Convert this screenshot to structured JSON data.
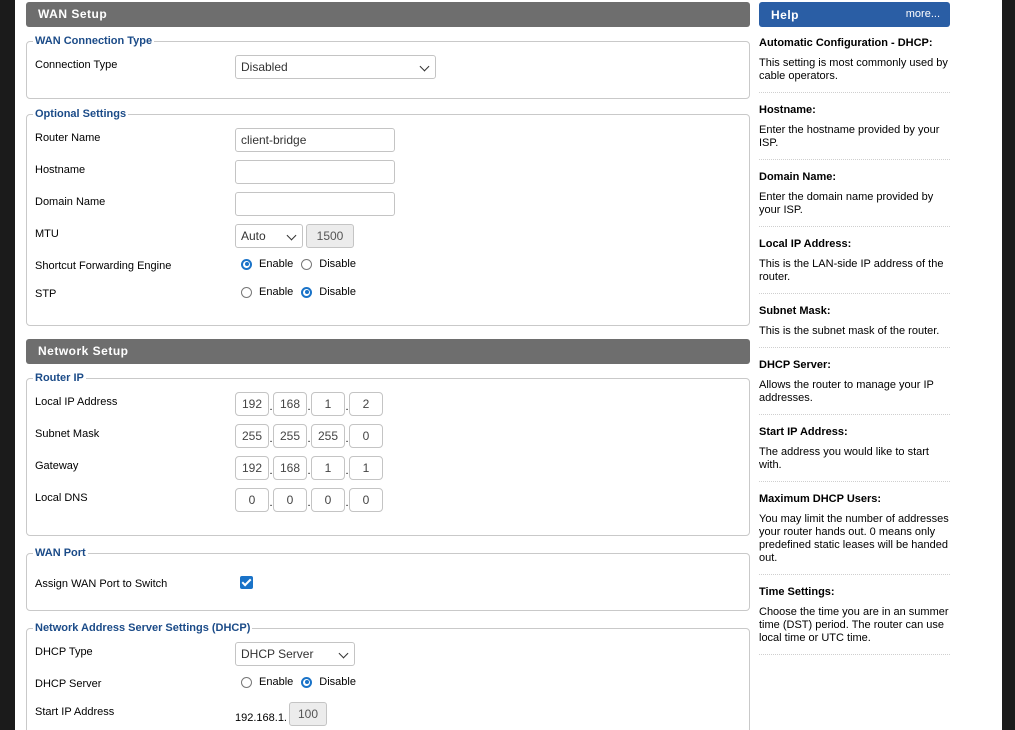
{
  "wan": {
    "header": "WAN Setup",
    "conn_legend": "WAN Connection Type",
    "conn_type_label": "Connection Type",
    "conn_type_value": "Disabled",
    "opt_legend": "Optional Settings",
    "router_name_label": "Router Name",
    "router_name_value": "client-bridge",
    "hostname_label": "Hostname",
    "hostname_value": "",
    "domain_label": "Domain Name",
    "domain_value": "",
    "mtu_label": "MTU",
    "mtu_mode": "Auto",
    "mtu_value": "1500",
    "sfe_label": "Shortcut Forwarding Engine",
    "sfe_enable": "Enable",
    "sfe_disable": "Disable",
    "stp_label": "STP",
    "stp_enable": "Enable",
    "stp_disable": "Disable"
  },
  "network": {
    "header": "Network Setup",
    "router_ip_legend": "Router IP",
    "local_ip_label": "Local IP Address",
    "local_ip": [
      "192",
      "168",
      "1",
      "2"
    ],
    "subnet_label": "Subnet Mask",
    "subnet": [
      "255",
      "255",
      "255",
      "0"
    ],
    "gateway_label": "Gateway",
    "gateway": [
      "192",
      "168",
      "1",
      "1"
    ],
    "dns_label": "Local DNS",
    "dns": [
      "0",
      "0",
      "0",
      "0"
    ],
    "wan_port_legend": "WAN Port",
    "assign_wan_label": "Assign WAN Port to Switch",
    "dhcp_legend": "Network Address Server Settings (DHCP)",
    "dhcp_type_label": "DHCP Type",
    "dhcp_type_value": "DHCP Server",
    "dhcp_server_label": "DHCP Server",
    "dhcp_enable": "Enable",
    "dhcp_disable": "Disable",
    "start_ip_label": "Start IP Address",
    "start_ip_prefix": "192.168.1.",
    "start_ip_value": "100"
  },
  "help": {
    "title": "Help",
    "more": "more...",
    "items": [
      {
        "title": "Automatic Configuration - DHCP:",
        "desc": "This setting is most commonly used by cable operators."
      },
      {
        "title": "Hostname:",
        "desc": "Enter the hostname provided by your ISP."
      },
      {
        "title": "Domain Name:",
        "desc": "Enter the domain name provided by your ISP."
      },
      {
        "title": "Local IP Address:",
        "desc": "This is the LAN-side IP address of the router."
      },
      {
        "title": "Subnet Mask:",
        "desc": "This is the subnet mask of the router."
      },
      {
        "title": "DHCP Server:",
        "desc": "Allows the router to manage your IP addresses."
      },
      {
        "title": "Start IP Address:",
        "desc": "The address you would like to start with."
      },
      {
        "title": "Maximum DHCP Users:",
        "desc": "You may limit the number of addresses your router hands out. 0 means only predefined static leases will be handed out."
      },
      {
        "title": "Time Settings:",
        "desc": "Choose the time you are in an summer time (DST) period. The router can use local time or UTC time."
      }
    ]
  },
  "colors": {
    "accent": "#1a73c8",
    "legend": "#1b4b88",
    "section_header": "#6e6e6e",
    "help_header": "#2a5ea5"
  }
}
